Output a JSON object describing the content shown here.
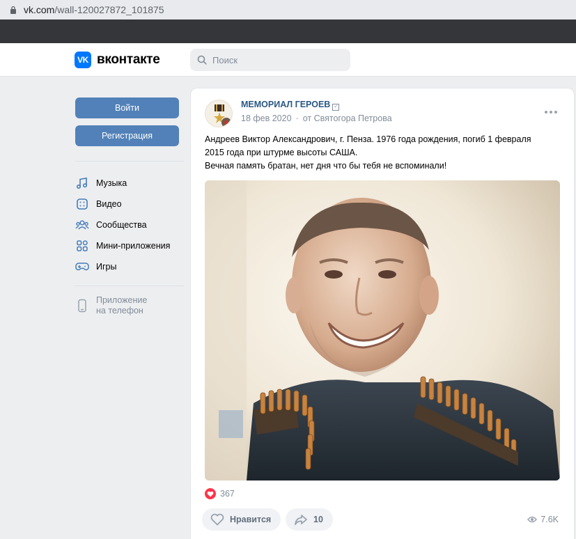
{
  "browser": {
    "url_host": "vk.com",
    "url_path": "/wall-120027872_101875"
  },
  "header": {
    "logo_mark": "VK",
    "logo_text": "вконтакте",
    "search_placeholder": "Поиск"
  },
  "sidebar": {
    "login_label": "Войти",
    "register_label": "Регистрация",
    "items": [
      {
        "label": "Музыка",
        "icon": "music-icon"
      },
      {
        "label": "Видео",
        "icon": "video-icon"
      },
      {
        "label": "Сообщества",
        "icon": "communities-icon"
      },
      {
        "label": "Мини-приложения",
        "icon": "mini-apps-icon"
      },
      {
        "label": "Игры",
        "icon": "gamepad-icon"
      }
    ],
    "app_promo_line1": "Приложение",
    "app_promo_line2": "на телефон"
  },
  "post": {
    "author": "МЕМОРИАЛ ГЕРОЕВ",
    "date": "18 фев 2020",
    "separator": "·",
    "signed_by": "от Святогора Петрова",
    "text_line1": "Андреев Виктор Александрович, г. Пенза. 1976 года рождения, погиб 1 февраля",
    "text_line2": "2015 года при штурме высоты САША.",
    "text_line3": "Вечная память братан, нет дня что бы тебя не вспоминали!",
    "likes_count": "367",
    "like_button_label": "Нравится",
    "share_count": "10",
    "views_count": "7.6K"
  },
  "colors": {
    "vk_blue": "#0077ff",
    "button_blue": "#5181b8",
    "link_blue": "#2a5885",
    "like_red": "#ff3347",
    "page_bg": "#edeef0"
  }
}
